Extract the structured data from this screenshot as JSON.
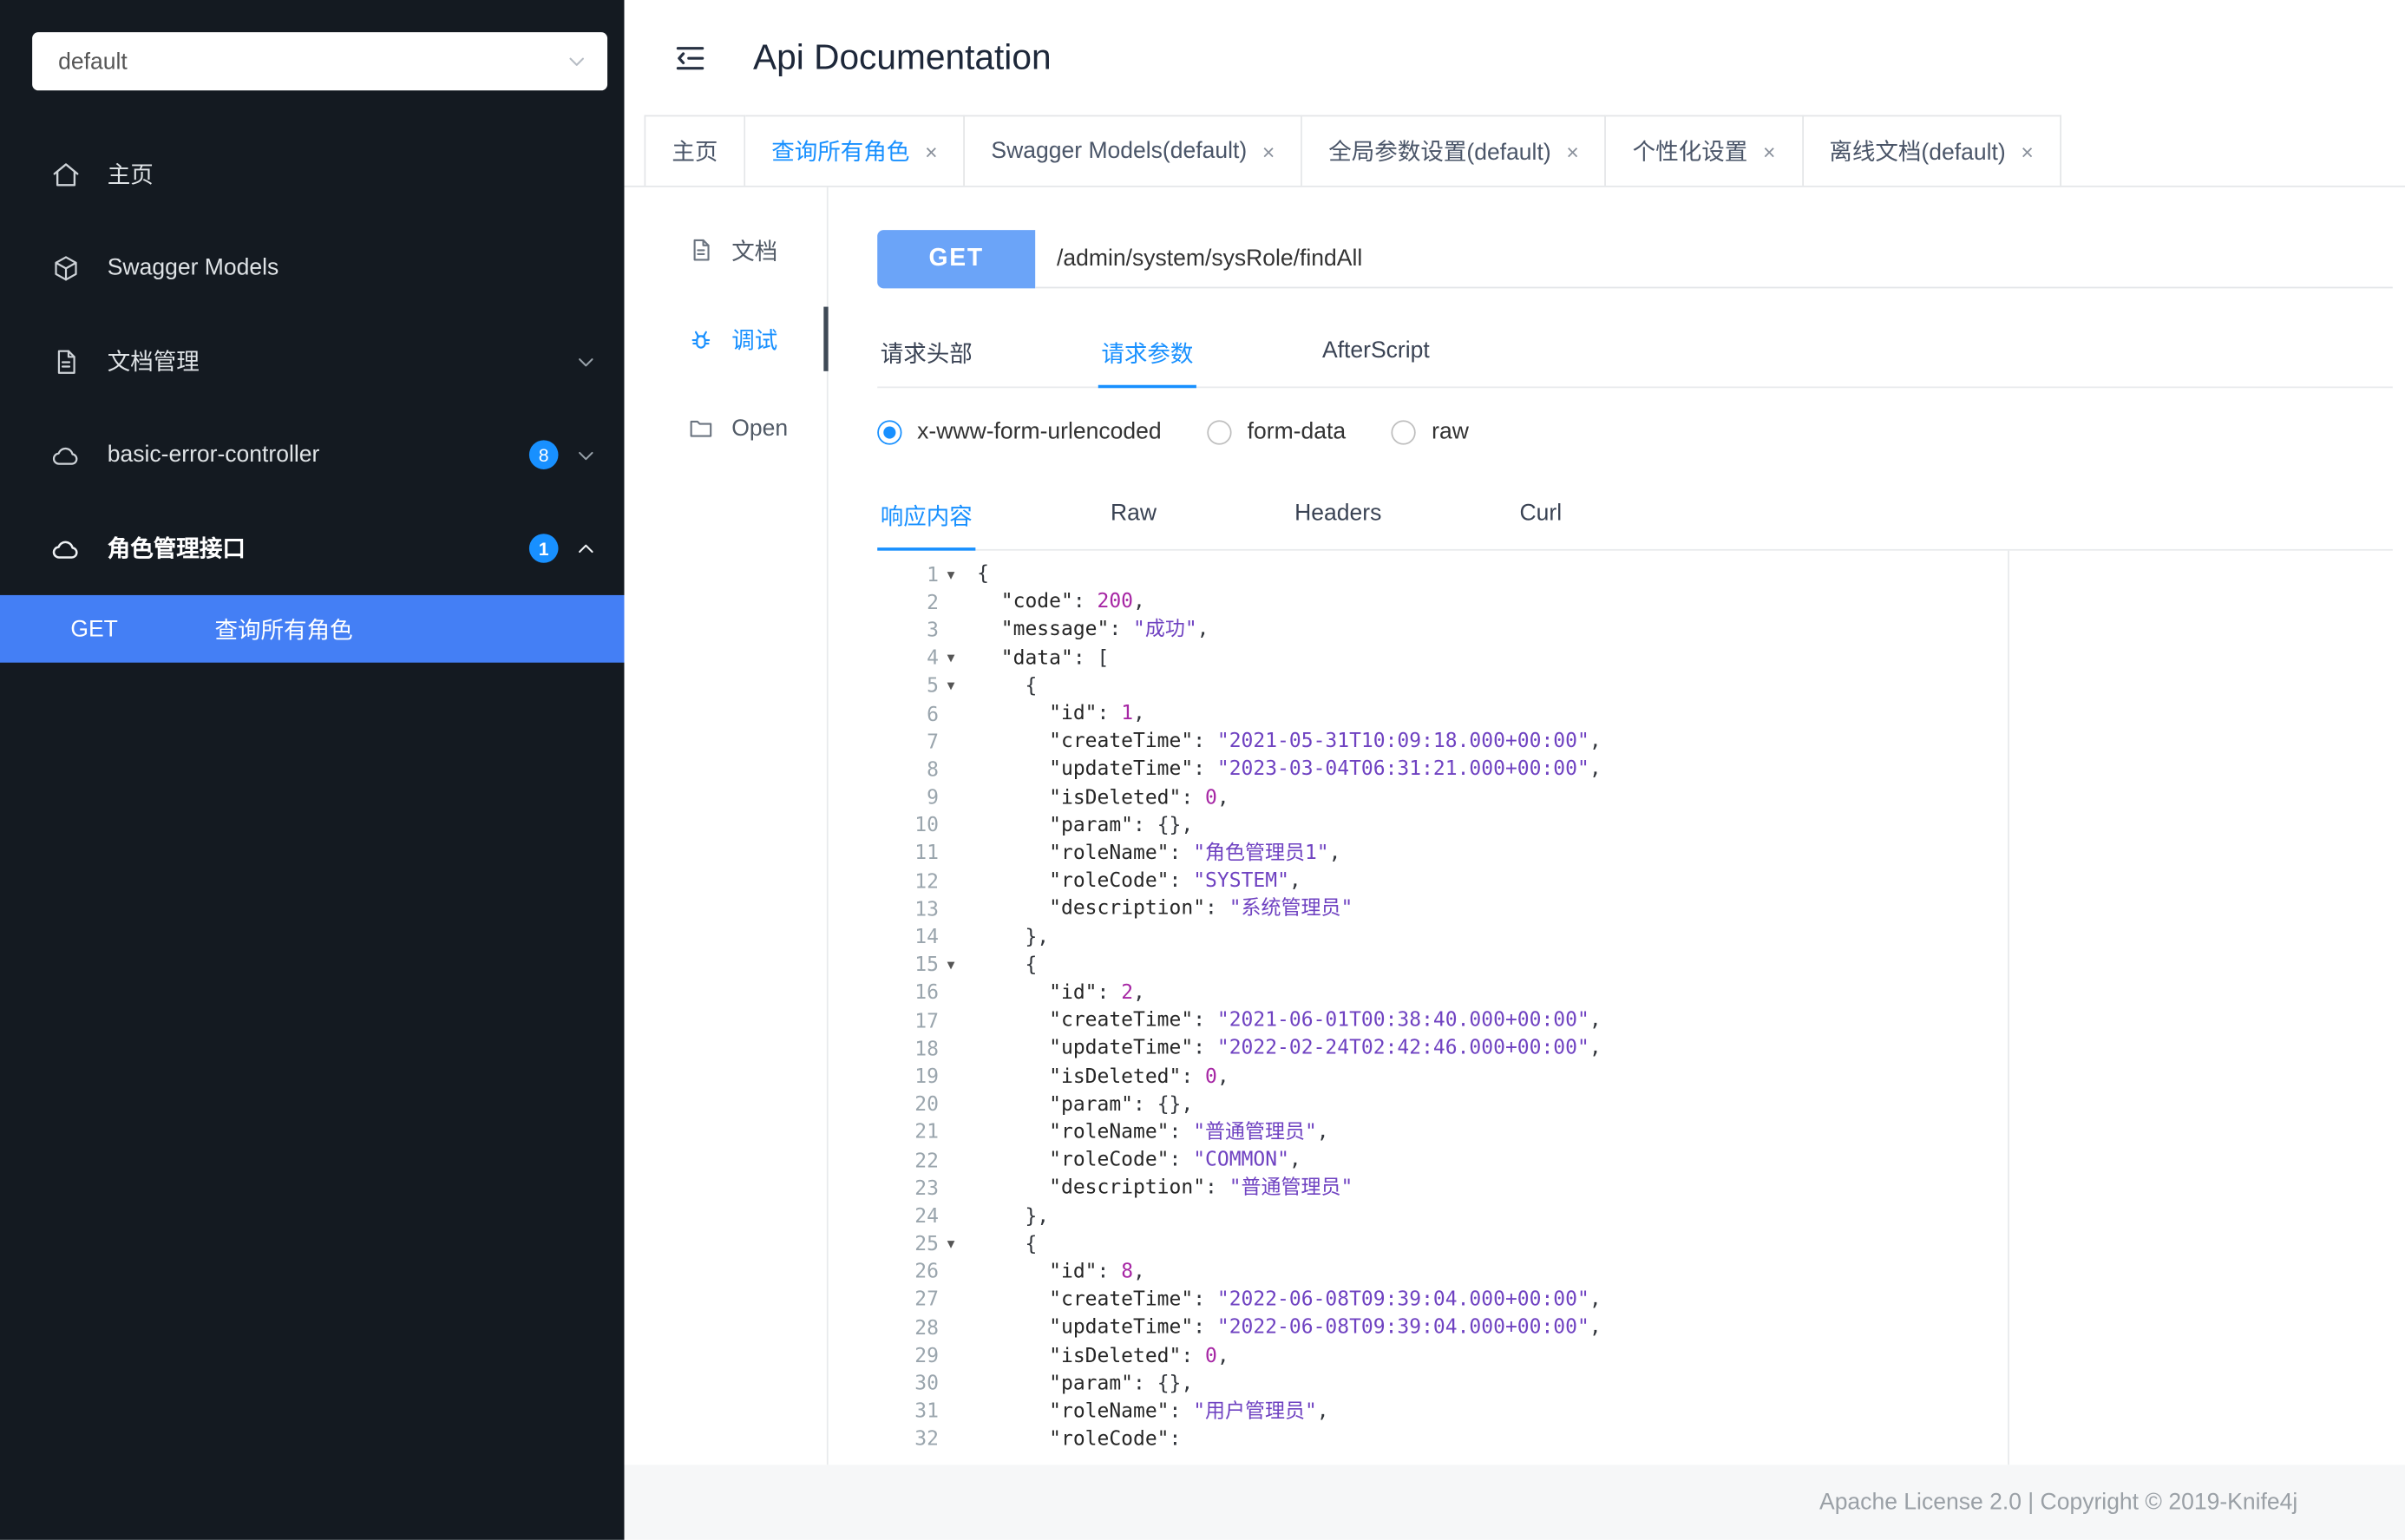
{
  "colors": {
    "accent": "#1890ff",
    "menu-selected": "#447ff5",
    "get-pill": "#6ba4f8",
    "sidebar-bg": "#141a21",
    "tk-num": "#a626a4",
    "tk-str": "#6f42c1",
    "tk-key": "#262626"
  },
  "sidebar": {
    "group_select": {
      "value": "default"
    },
    "items": [
      {
        "label": "主页"
      },
      {
        "label": "Swagger Models"
      },
      {
        "label": "文档管理"
      },
      {
        "label": "basic-error-controller",
        "badge": "8"
      },
      {
        "label": "角色管理接口",
        "badge": "1"
      }
    ],
    "submenu": {
      "method": "GET",
      "label": "查询所有角色"
    }
  },
  "header": {
    "title": "Api Documentation"
  },
  "tabstrip": {
    "tabs": [
      {
        "label": "主页"
      },
      {
        "label": "查询所有角色"
      },
      {
        "label": "Swagger Models(default)"
      },
      {
        "label": "全局参数设置(default)"
      },
      {
        "label": "个性化设置"
      },
      {
        "label": "离线文档(default)"
      }
    ]
  },
  "side_tabs": {
    "items": [
      {
        "label": "文档"
      },
      {
        "label": "调试"
      },
      {
        "label": "Open"
      }
    ]
  },
  "request": {
    "method": "GET",
    "url": "/admin/system/sysRole/findAll",
    "tabs": [
      "请求头部",
      "请求参数",
      "AfterScript"
    ],
    "body_types": [
      "x-www-form-urlencoded",
      "form-data",
      "raw"
    ],
    "selected_body_type": "x-www-form-urlencoded"
  },
  "response": {
    "tabs": [
      "响应内容",
      "Raw",
      "Headers",
      "Curl"
    ]
  },
  "editor": {
    "lines": [
      {
        "n": 1,
        "fold": true,
        "t": [
          [
            "p",
            "{"
          ]
        ]
      },
      {
        "n": 2,
        "fold": false,
        "t": [
          [
            "p",
            "  "
          ],
          [
            "k",
            "\"code\""
          ],
          [
            "p",
            ": "
          ],
          [
            "n",
            "200"
          ],
          [
            "p",
            ","
          ]
        ]
      },
      {
        "n": 3,
        "fold": false,
        "t": [
          [
            "p",
            "  "
          ],
          [
            "k",
            "\"message\""
          ],
          [
            "p",
            ": "
          ],
          [
            "s",
            "\"成功\""
          ],
          [
            "p",
            ","
          ]
        ]
      },
      {
        "n": 4,
        "fold": true,
        "t": [
          [
            "p",
            "  "
          ],
          [
            "k",
            "\"data\""
          ],
          [
            "p",
            ": ["
          ]
        ]
      },
      {
        "n": 5,
        "fold": true,
        "t": [
          [
            "p",
            "    {"
          ]
        ]
      },
      {
        "n": 6,
        "fold": false,
        "t": [
          [
            "p",
            "      "
          ],
          [
            "k",
            "\"id\""
          ],
          [
            "p",
            ": "
          ],
          [
            "n",
            "1"
          ],
          [
            "p",
            ","
          ]
        ]
      },
      {
        "n": 7,
        "fold": false,
        "t": [
          [
            "p",
            "      "
          ],
          [
            "k",
            "\"createTime\""
          ],
          [
            "p",
            ": "
          ],
          [
            "s",
            "\"2021-05-31T10:09:18.000+00:00\""
          ],
          [
            "p",
            ","
          ]
        ]
      },
      {
        "n": 8,
        "fold": false,
        "t": [
          [
            "p",
            "      "
          ],
          [
            "k",
            "\"updateTime\""
          ],
          [
            "p",
            ": "
          ],
          [
            "s",
            "\"2023-03-04T06:31:21.000+00:00\""
          ],
          [
            "p",
            ","
          ]
        ]
      },
      {
        "n": 9,
        "fold": false,
        "t": [
          [
            "p",
            "      "
          ],
          [
            "k",
            "\"isDeleted\""
          ],
          [
            "p",
            ": "
          ],
          [
            "n",
            "0"
          ],
          [
            "p",
            ","
          ]
        ]
      },
      {
        "n": 10,
        "fold": false,
        "t": [
          [
            "p",
            "      "
          ],
          [
            "k",
            "\"param\""
          ],
          [
            "p",
            ": {},"
          ]
        ]
      },
      {
        "n": 11,
        "fold": false,
        "t": [
          [
            "p",
            "      "
          ],
          [
            "k",
            "\"roleName\""
          ],
          [
            "p",
            ": "
          ],
          [
            "s",
            "\"角色管理员1\""
          ],
          [
            "p",
            ","
          ]
        ]
      },
      {
        "n": 12,
        "fold": false,
        "t": [
          [
            "p",
            "      "
          ],
          [
            "k",
            "\"roleCode\""
          ],
          [
            "p",
            ": "
          ],
          [
            "s",
            "\"SYSTEM\""
          ],
          [
            "p",
            ","
          ]
        ]
      },
      {
        "n": 13,
        "fold": false,
        "t": [
          [
            "p",
            "      "
          ],
          [
            "k",
            "\"description\""
          ],
          [
            "p",
            ": "
          ],
          [
            "s",
            "\"系统管理员\""
          ]
        ]
      },
      {
        "n": 14,
        "fold": false,
        "t": [
          [
            "p",
            "    },"
          ]
        ]
      },
      {
        "n": 15,
        "fold": true,
        "t": [
          [
            "p",
            "    {"
          ]
        ]
      },
      {
        "n": 16,
        "fold": false,
        "t": [
          [
            "p",
            "      "
          ],
          [
            "k",
            "\"id\""
          ],
          [
            "p",
            ": "
          ],
          [
            "n",
            "2"
          ],
          [
            "p",
            ","
          ]
        ]
      },
      {
        "n": 17,
        "fold": false,
        "t": [
          [
            "p",
            "      "
          ],
          [
            "k",
            "\"createTime\""
          ],
          [
            "p",
            ": "
          ],
          [
            "s",
            "\"2021-06-01T00:38:40.000+00:00\""
          ],
          [
            "p",
            ","
          ]
        ]
      },
      {
        "n": 18,
        "fold": false,
        "t": [
          [
            "p",
            "      "
          ],
          [
            "k",
            "\"updateTime\""
          ],
          [
            "p",
            ": "
          ],
          [
            "s",
            "\"2022-02-24T02:42:46.000+00:00\""
          ],
          [
            "p",
            ","
          ]
        ]
      },
      {
        "n": 19,
        "fold": false,
        "t": [
          [
            "p",
            "      "
          ],
          [
            "k",
            "\"isDeleted\""
          ],
          [
            "p",
            ": "
          ],
          [
            "n",
            "0"
          ],
          [
            "p",
            ","
          ]
        ]
      },
      {
        "n": 20,
        "fold": false,
        "t": [
          [
            "p",
            "      "
          ],
          [
            "k",
            "\"param\""
          ],
          [
            "p",
            ": {},"
          ]
        ]
      },
      {
        "n": 21,
        "fold": false,
        "t": [
          [
            "p",
            "      "
          ],
          [
            "k",
            "\"roleName\""
          ],
          [
            "p",
            ": "
          ],
          [
            "s",
            "\"普通管理员\""
          ],
          [
            "p",
            ","
          ]
        ]
      },
      {
        "n": 22,
        "fold": false,
        "t": [
          [
            "p",
            "      "
          ],
          [
            "k",
            "\"roleCode\""
          ],
          [
            "p",
            ": "
          ],
          [
            "s",
            "\"COMMON\""
          ],
          [
            "p",
            ","
          ]
        ]
      },
      {
        "n": 23,
        "fold": false,
        "t": [
          [
            "p",
            "      "
          ],
          [
            "k",
            "\"description\""
          ],
          [
            "p",
            ": "
          ],
          [
            "s",
            "\"普通管理员\""
          ]
        ]
      },
      {
        "n": 24,
        "fold": false,
        "t": [
          [
            "p",
            "    },"
          ]
        ]
      },
      {
        "n": 25,
        "fold": true,
        "t": [
          [
            "p",
            "    {"
          ]
        ]
      },
      {
        "n": 26,
        "fold": false,
        "t": [
          [
            "p",
            "      "
          ],
          [
            "k",
            "\"id\""
          ],
          [
            "p",
            ": "
          ],
          [
            "n",
            "8"
          ],
          [
            "p",
            ","
          ]
        ]
      },
      {
        "n": 27,
        "fold": false,
        "t": [
          [
            "p",
            "      "
          ],
          [
            "k",
            "\"createTime\""
          ],
          [
            "p",
            ": "
          ],
          [
            "s",
            "\"2022-06-08T09:39:04.000+00:00\""
          ],
          [
            "p",
            ","
          ]
        ]
      },
      {
        "n": 28,
        "fold": false,
        "t": [
          [
            "p",
            "      "
          ],
          [
            "k",
            "\"updateTime\""
          ],
          [
            "p",
            ": "
          ],
          [
            "s",
            "\"2022-06-08T09:39:04.000+00:00\""
          ],
          [
            "p",
            ","
          ]
        ]
      },
      {
        "n": 29,
        "fold": false,
        "t": [
          [
            "p",
            "      "
          ],
          [
            "k",
            "\"isDeleted\""
          ],
          [
            "p",
            ": "
          ],
          [
            "n",
            "0"
          ],
          [
            "p",
            ","
          ]
        ]
      },
      {
        "n": 30,
        "fold": false,
        "t": [
          [
            "p",
            "      "
          ],
          [
            "k",
            "\"param\""
          ],
          [
            "p",
            ": {},"
          ]
        ]
      },
      {
        "n": 31,
        "fold": false,
        "t": [
          [
            "p",
            "      "
          ],
          [
            "k",
            "\"roleName\""
          ],
          [
            "p",
            ": "
          ],
          [
            "s",
            "\"用户管理员\""
          ],
          [
            "p",
            ","
          ]
        ]
      },
      {
        "n": 32,
        "fold": false,
        "t": [
          [
            "p",
            "      "
          ],
          [
            "k",
            "\"roleCode\""
          ],
          [
            "p",
            ": "
          ]
        ]
      }
    ]
  },
  "footer": {
    "text": "Apache License 2.0 | Copyright © 2019-Knife4j"
  }
}
